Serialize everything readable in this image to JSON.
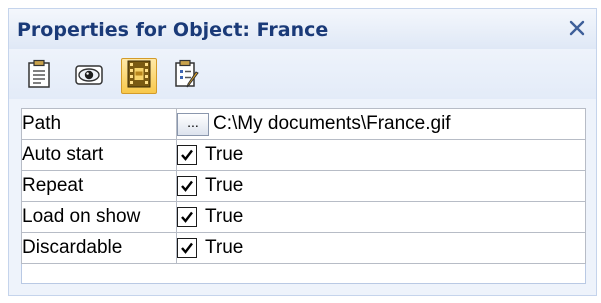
{
  "panel": {
    "title": "Properties for Object: France",
    "close_icon": "close-icon"
  },
  "toolbar": {
    "tabs": [
      {
        "icon": "clipboard-icon",
        "active": false
      },
      {
        "icon": "eye-icon",
        "active": false
      },
      {
        "icon": "film-gif-icon",
        "active": true
      },
      {
        "icon": "clipboard-edit-icon",
        "active": false
      }
    ]
  },
  "properties": {
    "rows": [
      {
        "name": "Path",
        "browse_label": "...",
        "value": "C:\\My documents\\France.gif"
      },
      {
        "name": "Auto start",
        "checked": true,
        "value": "True"
      },
      {
        "name": "Repeat",
        "checked": true,
        "value": "True"
      },
      {
        "name": "Load on show",
        "checked": true,
        "value": "True"
      },
      {
        "name": "Discardable",
        "checked": true,
        "value": "True"
      }
    ]
  },
  "colors": {
    "title_text": "#1a3a78",
    "panel_bg": "#eef3fb",
    "active_tab": "#f8c84a"
  }
}
